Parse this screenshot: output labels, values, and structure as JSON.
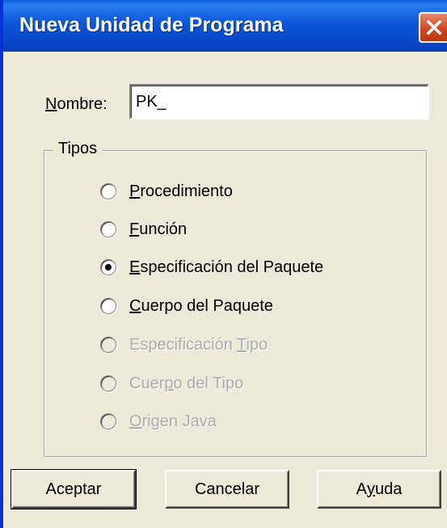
{
  "dialog": {
    "title": "Nueva Unidad de Programa",
    "name_label_prefix": "N",
    "name_label_rest": "ombre:",
    "name_value": "PK_",
    "group_label": "Tipos",
    "options": [
      {
        "pre": "",
        "accel": "P",
        "post": "rocedimiento",
        "checked": false,
        "enabled": true
      },
      {
        "pre": "",
        "accel": "F",
        "post": "unción",
        "checked": false,
        "enabled": true
      },
      {
        "pre": "",
        "accel": "E",
        "post": "specificación del Paquete",
        "checked": true,
        "enabled": true
      },
      {
        "pre": "",
        "accel": "C",
        "post": "uerpo del Paquete",
        "checked": false,
        "enabled": true
      },
      {
        "pre": "Especificación ",
        "accel": "T",
        "post": "ipo",
        "checked": false,
        "enabled": false
      },
      {
        "pre": "Cuer",
        "accel": "p",
        "post": "o del Tipo",
        "checked": false,
        "enabled": false
      },
      {
        "pre": "",
        "accel": "O",
        "post": "rigen Java",
        "checked": false,
        "enabled": false
      }
    ],
    "buttons": {
      "ok": "Aceptar",
      "cancel": "Cancelar",
      "help_pre": "A",
      "help_accel": "y",
      "help_post": "uda"
    }
  },
  "colors": {
    "title_bar": "#0b55d8",
    "close_button": "#c9461f",
    "dialog_bg": "#ece9d8",
    "disabled_text": "#ababab"
  }
}
